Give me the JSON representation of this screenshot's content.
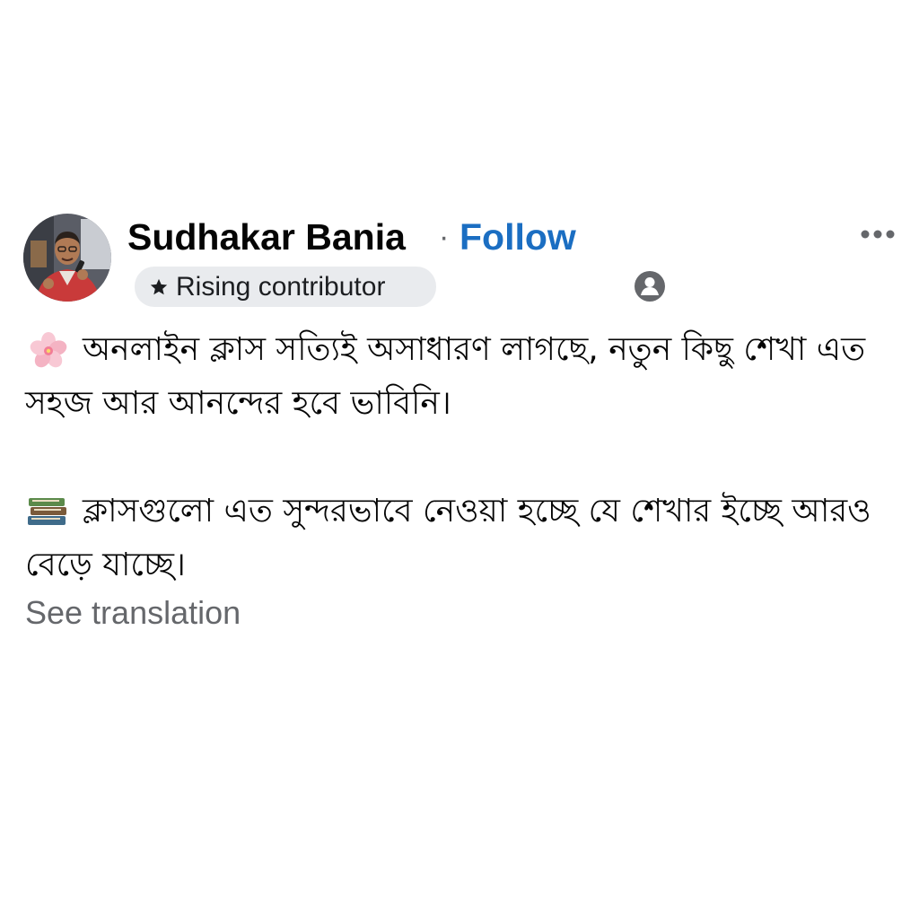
{
  "post": {
    "author": {
      "name": "Sudhakar Bania",
      "separator": "·",
      "follow_label": "Follow",
      "badge": {
        "label": "Rising contributor",
        "icon": "star-icon"
      }
    },
    "more_icon": "more-options-icon",
    "audience_icon": "friends-audience-icon",
    "paragraphs": [
      {
        "emoji": "cherry-blossom-emoji",
        "text": "অনলাইন ক্লাস সত্যিই অসাধারণ লাগছে, নতুন কিছু শেখা এত সহজ আর আনন্দের হবে ভাবিনি।"
      },
      {
        "emoji": "books-emoji",
        "text": "ক্লাসগুলো এত সুন্দরভাবে নেওয়া হচ্ছে যে শেখার ইচ্ছে আরও বেড়ে যাচ্ছে।"
      }
    ],
    "see_translation": "See translation",
    "colors": {
      "name": "#050505",
      "follow": "#1b6ec2",
      "secondary_text": "#65676b",
      "badge_bg": "#e9ebee"
    }
  }
}
